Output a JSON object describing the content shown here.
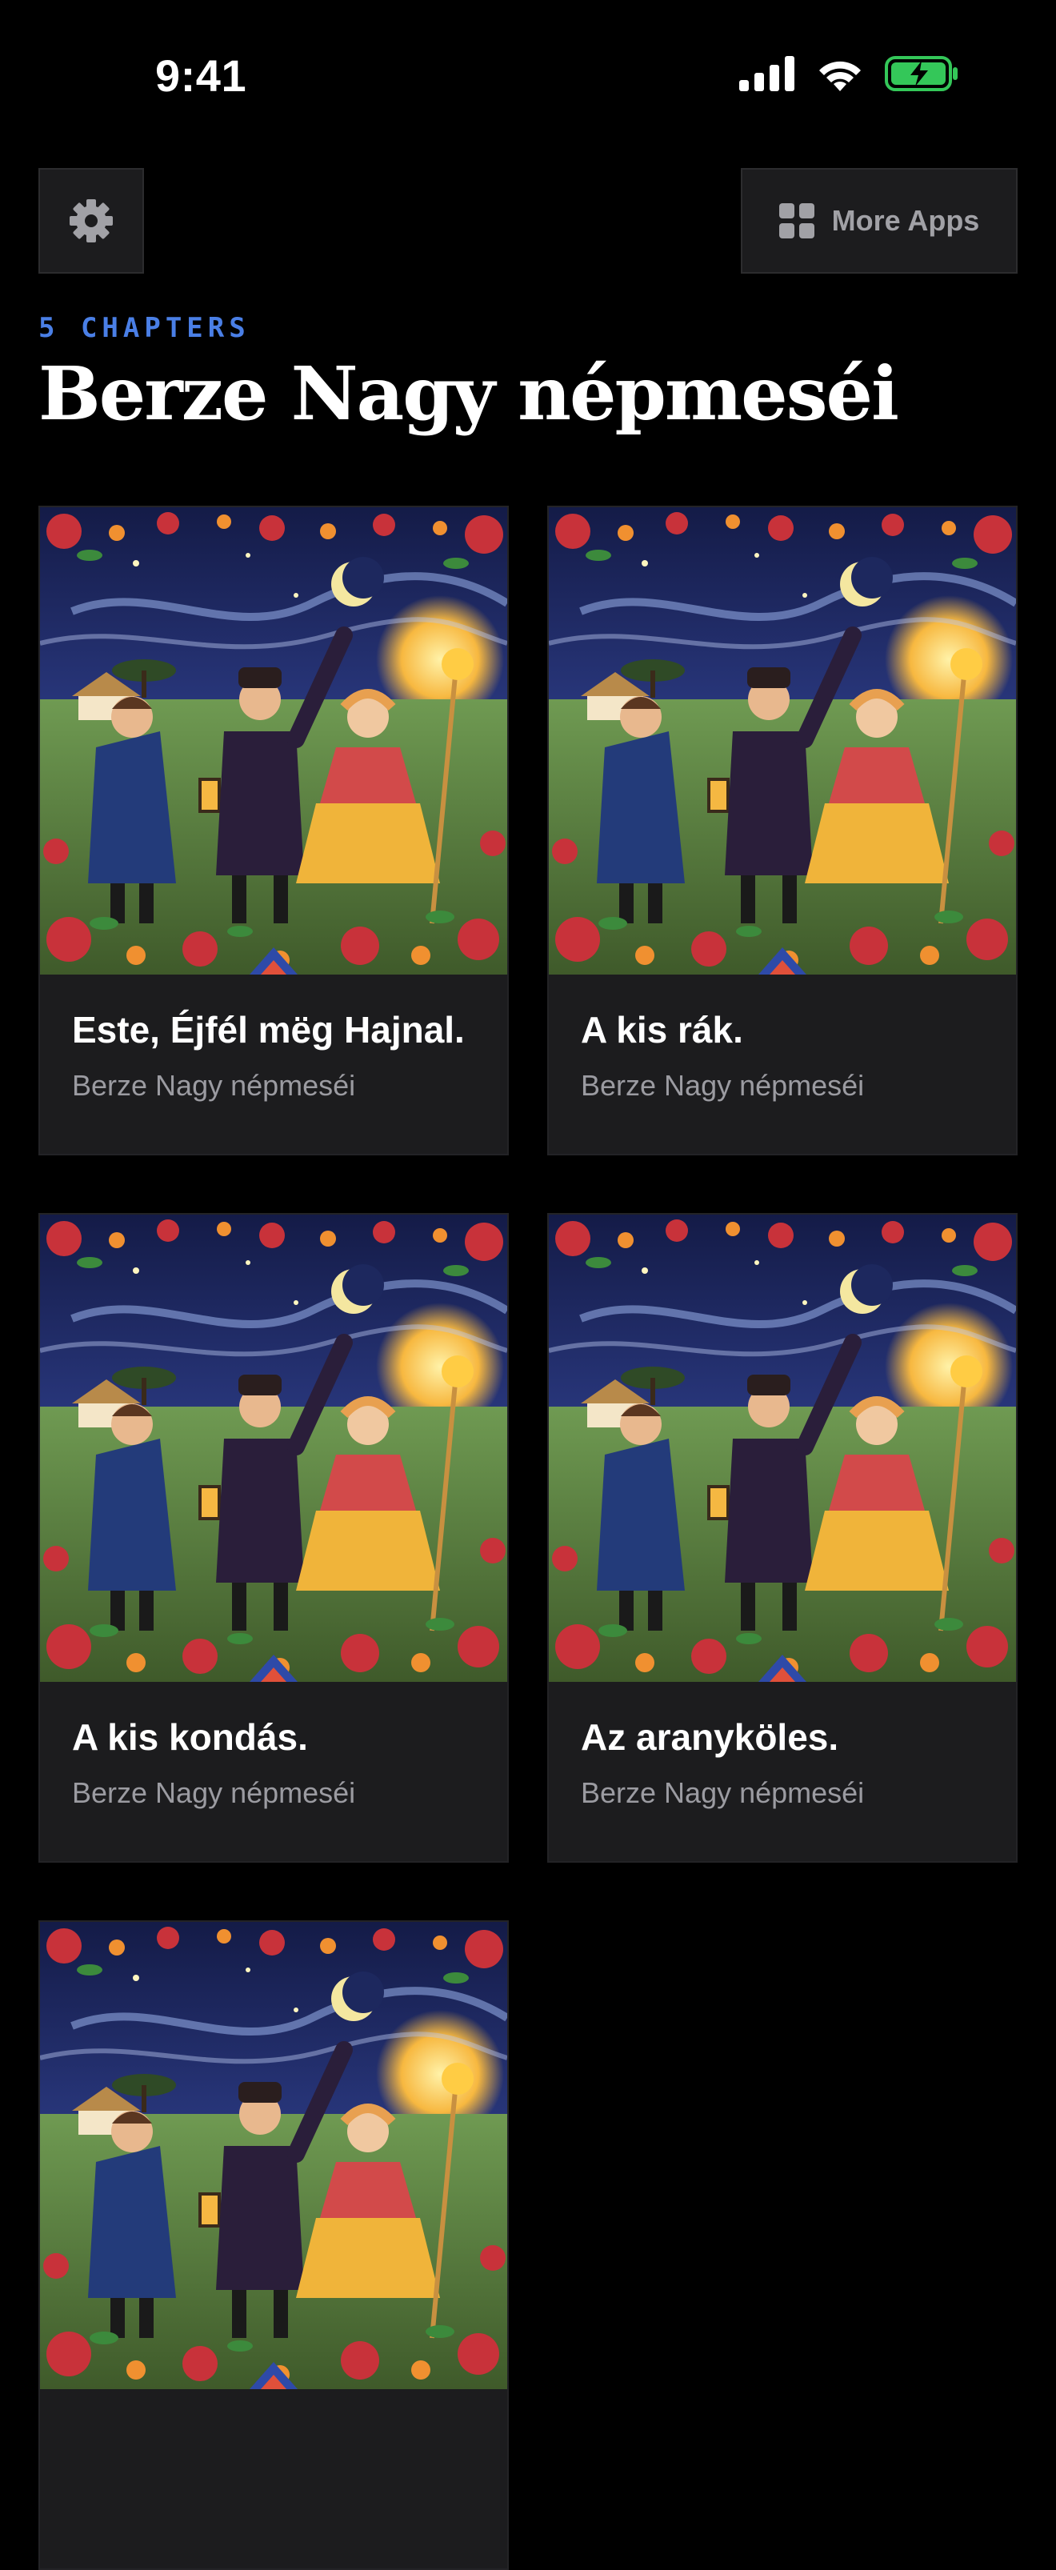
{
  "status_bar": {
    "time": "9:41"
  },
  "header": {
    "settings_icon": "gear-icon",
    "more_apps_label": "More Apps",
    "more_apps_icon": "grid-icon"
  },
  "collection": {
    "count_label": "5 CHAPTERS",
    "title": "Berze Nagy népmeséi"
  },
  "cards": [
    {
      "title": "Este, Éjfél mëg Hajnal.",
      "subtitle": "Berze Nagy népmeséi"
    },
    {
      "title": "A kis rák.",
      "subtitle": "Berze Nagy népmeséi"
    },
    {
      "title": "A kis kondás.",
      "subtitle": "Berze Nagy népmeséi"
    },
    {
      "title": "Az aranyköles.",
      "subtitle": "Berze Nagy népmeséi"
    },
    {
      "title": "",
      "subtitle": ""
    }
  ],
  "colors": {
    "accent": "#4a7fe6",
    "battery": "#34c759",
    "card_bg": "#1c1c1e"
  }
}
